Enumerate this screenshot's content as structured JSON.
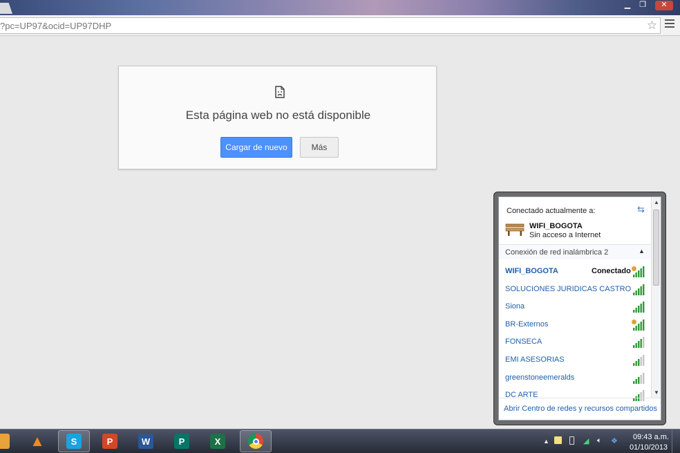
{
  "browser": {
    "url": "?pc=UP97&ocid=UP97DHP",
    "window_controls": {
      "minimize": "▁",
      "maximize": "❐",
      "close": "✕"
    }
  },
  "error_page": {
    "title": "Esta página web no está disponible",
    "reload_label": "Cargar de nuevo",
    "more_label": "Más",
    "icon": "sad-page-icon"
  },
  "network_flyout": {
    "current_label": "Conectado actualmente a:",
    "current_network": {
      "name": "WIFI_BOGOTA",
      "status": "Sin acceso a Internet",
      "icon": "bench-icon"
    },
    "adapter_label": "Conexión de red inalámbrica 2",
    "networks": [
      {
        "name": "WIFI_BOGOTA",
        "status": "Conectado",
        "bars": 5,
        "shield": true
      },
      {
        "name": "SOLUCIONES JURIDICAS CASTRO",
        "status": "",
        "bars": 5,
        "shield": false
      },
      {
        "name": "Siona",
        "status": "",
        "bars": 5,
        "shield": false
      },
      {
        "name": "BR-Externos",
        "status": "",
        "bars": 5,
        "shield": true
      },
      {
        "name": "FONSECA",
        "status": "",
        "bars": 4,
        "shield": false
      },
      {
        "name": "EMI ASESORIAS",
        "status": "",
        "bars": 3,
        "shield": false
      },
      {
        "name": "greenstoneemeralds",
        "status": "",
        "bars": 3,
        "shield": false
      },
      {
        "name": "DC ARTE",
        "status": "",
        "bars": 3,
        "shield": false
      }
    ],
    "footer_link": "Abrir Centro de redes y recursos compartidos"
  },
  "taskbar": {
    "apps": [
      {
        "name": "explorer",
        "icon": "explorer-icon",
        "color": "#e8a23a",
        "glyph": ""
      },
      {
        "name": "vlc",
        "icon": "vlc-icon",
        "color": "#f08a1c",
        "glyph": "▲"
      },
      {
        "name": "skype",
        "icon": "skype-icon",
        "color": "#1aa3e0",
        "glyph": "S"
      },
      {
        "name": "powerpoint",
        "icon": "powerpoint-icon",
        "color": "#d24726",
        "glyph": "P"
      },
      {
        "name": "word",
        "icon": "word-icon",
        "color": "#2b5797",
        "glyph": "W"
      },
      {
        "name": "publisher",
        "icon": "publisher-icon",
        "color": "#077568",
        "glyph": "P"
      },
      {
        "name": "excel",
        "icon": "excel-icon",
        "color": "#1e7145",
        "glyph": "X"
      },
      {
        "name": "chrome",
        "icon": "chrome-icon",
        "color": "#dd4b39",
        "glyph": ""
      }
    ],
    "tray": {
      "show_hidden": "▲",
      "time": "09:43 a.m.",
      "date": "01/10/2013"
    }
  }
}
